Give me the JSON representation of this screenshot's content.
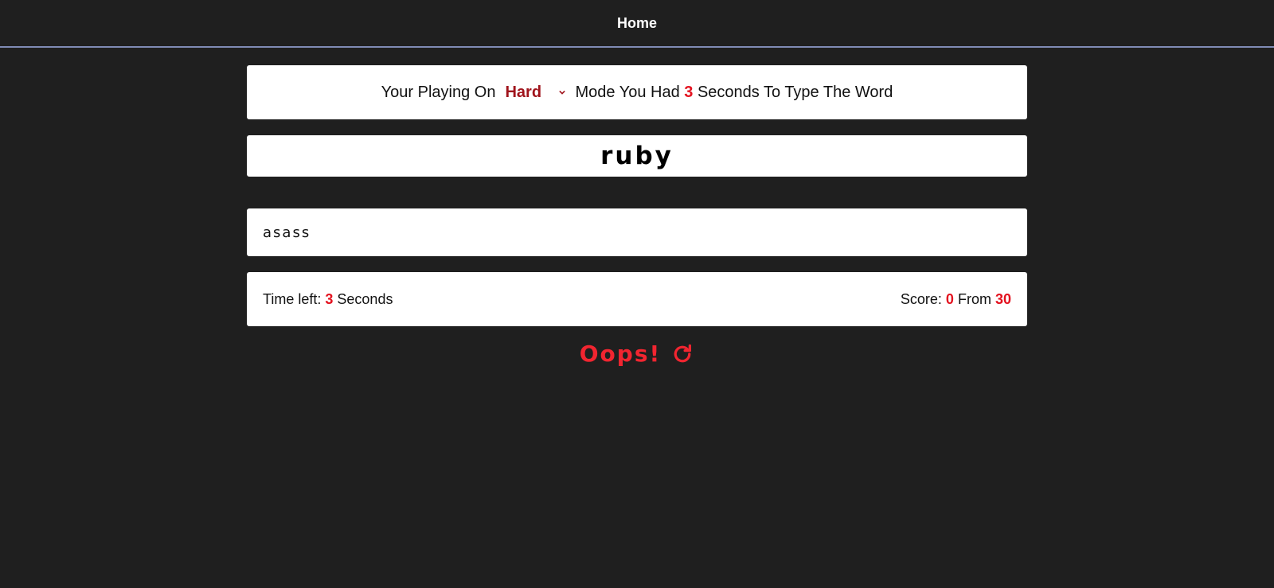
{
  "nav": {
    "home_label": "Home"
  },
  "mode_bar": {
    "prefix": "Your Playing On",
    "selected_mode": "Hard",
    "middle": "Mode You Had",
    "seconds": "3",
    "suffix": "Seconds To Type The Word"
  },
  "current_word": "ruby",
  "input": {
    "value": "asass"
  },
  "status": {
    "time_label": "Time left:",
    "time_value": "3",
    "time_unit": "Seconds",
    "score_label": "Score:",
    "score_value": "0",
    "from_label": "From",
    "total_words": "30"
  },
  "result": {
    "message": "Oops!",
    "icon": "restart-icon"
  },
  "colors": {
    "background": "#1f1f1f",
    "accent_red": "#e3121f",
    "mode_red": "#a0141c",
    "nav_border": "#7f8bb4"
  }
}
